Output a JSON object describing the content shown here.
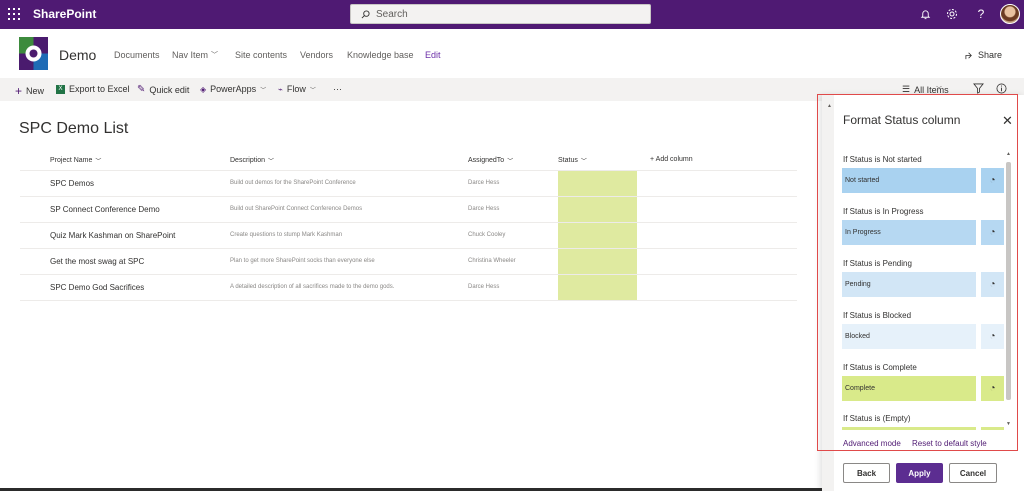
{
  "suite": {
    "app_name": "SharePoint",
    "search_placeholder": "Search"
  },
  "site": {
    "title": "Demo",
    "nav": [
      "Documents",
      "Nav Item",
      "Site contents",
      "Vendors",
      "Knowledge base",
      "Edit"
    ],
    "share_label": "Share"
  },
  "commands": {
    "new": "New",
    "export": "Export to Excel",
    "quick_edit": "Quick edit",
    "powerapps": "PowerApps",
    "flow": "Flow",
    "more": "···",
    "view": "All Items"
  },
  "list": {
    "title": "SPC Demo List",
    "columns": [
      "Project Name",
      "Description",
      "AssignedTo",
      "Status",
      "+ Add column"
    ],
    "rows": [
      {
        "title": "SPC Demos",
        "description": "Build out demos for the SharePoint Conference",
        "assigned": "Darce Hess"
      },
      {
        "title": "SP Connect Conference Demo",
        "description": "Build out SharePoint Connect Conference Demos",
        "assigned": "Darce Hess"
      },
      {
        "title": "Quiz Mark Kashman on SharePoint",
        "description": "Create questions to stump Mark Kashman",
        "assigned": "Chuck Cooley"
      },
      {
        "title": "Get the most swag at SPC",
        "description": "Plan to get more SharePoint socks than everyone else",
        "assigned": "Christina Wheeler"
      },
      {
        "title": "SPC Demo God Sacrifices",
        "description": "A detailed description of all sacrifices made to the demo gods.",
        "assigned": "Darce Hess"
      }
    ],
    "status_color": "#dfeaa0"
  },
  "panel": {
    "title": "Format Status column",
    "rules": [
      {
        "label": "If Status is Not started",
        "value": "Not started",
        "color": "#a9d2f0"
      },
      {
        "label": "If Status is In Progress",
        "value": "In Progress",
        "color": "#b6d8f2"
      },
      {
        "label": "If Status is Pending",
        "value": "Pending",
        "color": "#d2e6f6"
      },
      {
        "label": "If Status is Blocked",
        "value": "Blocked",
        "color": "#e6f1fa"
      },
      {
        "label": "If Status is Complete",
        "value": "Complete",
        "color": "#d9ea8a"
      },
      {
        "label": "If Status is (Empty)",
        "value": "",
        "color": "#d9ea8a"
      }
    ],
    "advanced_mode": "Advanced mode",
    "reset": "Reset to default style",
    "back": "Back",
    "apply": "Apply",
    "cancel": "Cancel"
  }
}
